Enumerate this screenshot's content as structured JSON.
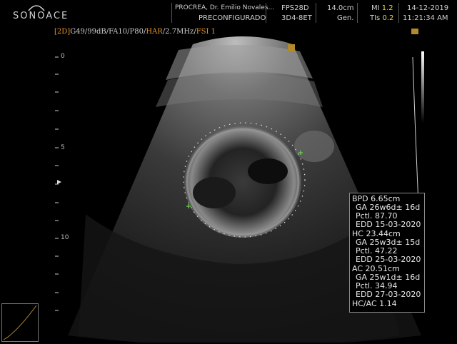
{
  "header": {
    "logo": "SONOACE",
    "clinic": "PROCREA, Dr. Emilio Novales...",
    "preset": "PRECONFIGURADO",
    "probe_mode": "FPS28D",
    "probe": "3D4-8ET",
    "depth": "14.0cm",
    "gen": "Gen.",
    "mi_label": "MI",
    "mi_value": "1.2",
    "tis_label": "TIs",
    "tis_value": "0.2",
    "date": "14-12-2019",
    "time": "11:21:34 AM"
  },
  "params": {
    "mode": "[2D]",
    "g": "G49/99dB/FA10/P80/",
    "har": "HAR",
    "freq": "/2.7MHz/",
    "fsi": "FSI 1"
  },
  "depth_scale": [
    "0",
    "5",
    "10"
  ],
  "measurements": {
    "lines": [
      "BPD 6.65cm",
      " GA 26w6d± 16d",
      " Pctl. 87.70",
      " EDD 15-03-2020",
      "HC 23.44cm",
      " GA 25w3d± 15d",
      " Pctl. 47.22",
      " EDD 25-03-2020",
      "AC 20.51cm",
      " GA 25w1d± 16d",
      " Pctl. 34.94",
      " EDD 27-03-2020",
      "HC/AC 1.14"
    ]
  },
  "colors": {
    "accent_yellow": "#e8d24a",
    "accent_orange": "#e7962a",
    "caliper_green": "#66dd44"
  }
}
